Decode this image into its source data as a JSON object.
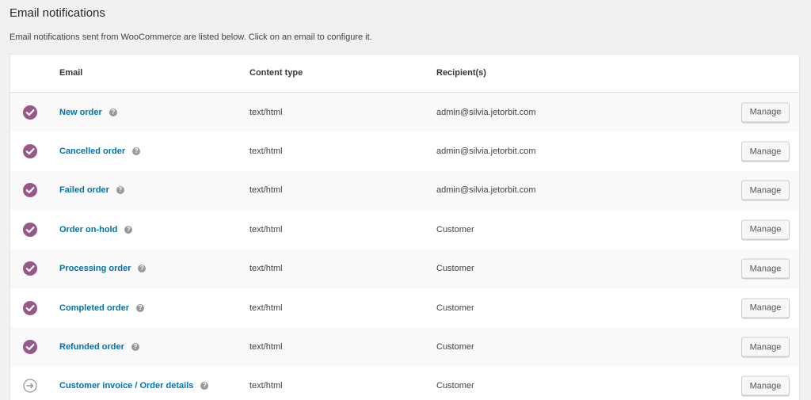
{
  "header": {
    "title": "Email notifications",
    "description": "Email notifications sent from WooCommerce are listed below. Click on an email to configure it."
  },
  "table": {
    "columns": {
      "email": "Email",
      "content_type": "Content type",
      "recipients": "Recipient(s)"
    },
    "manage_label": "Manage",
    "help_glyph": "?",
    "rows": [
      {
        "status": "enabled",
        "name": "New order",
        "content_type": "text/html",
        "recipient": "admin@silvia.jetorbit.com"
      },
      {
        "status": "enabled",
        "name": "Cancelled order",
        "content_type": "text/html",
        "recipient": "admin@silvia.jetorbit.com"
      },
      {
        "status": "enabled",
        "name": "Failed order",
        "content_type": "text/html",
        "recipient": "admin@silvia.jetorbit.com"
      },
      {
        "status": "enabled",
        "name": "Order on-hold",
        "content_type": "text/html",
        "recipient": "Customer"
      },
      {
        "status": "enabled",
        "name": "Processing order",
        "content_type": "text/html",
        "recipient": "Customer"
      },
      {
        "status": "enabled",
        "name": "Completed order",
        "content_type": "text/html",
        "recipient": "Customer"
      },
      {
        "status": "enabled",
        "name": "Refunded order",
        "content_type": "text/html",
        "recipient": "Customer"
      },
      {
        "status": "manual",
        "name": "Customer invoice / Order details",
        "content_type": "text/html",
        "recipient": "Customer"
      }
    ]
  },
  "colors": {
    "enabled_icon": "#96588a",
    "manual_icon": "#999999",
    "link": "#0073aa"
  },
  "icons": {
    "enabled": "check-circle-icon",
    "manual": "arrow-right-circle-icon",
    "help": "help-icon"
  }
}
